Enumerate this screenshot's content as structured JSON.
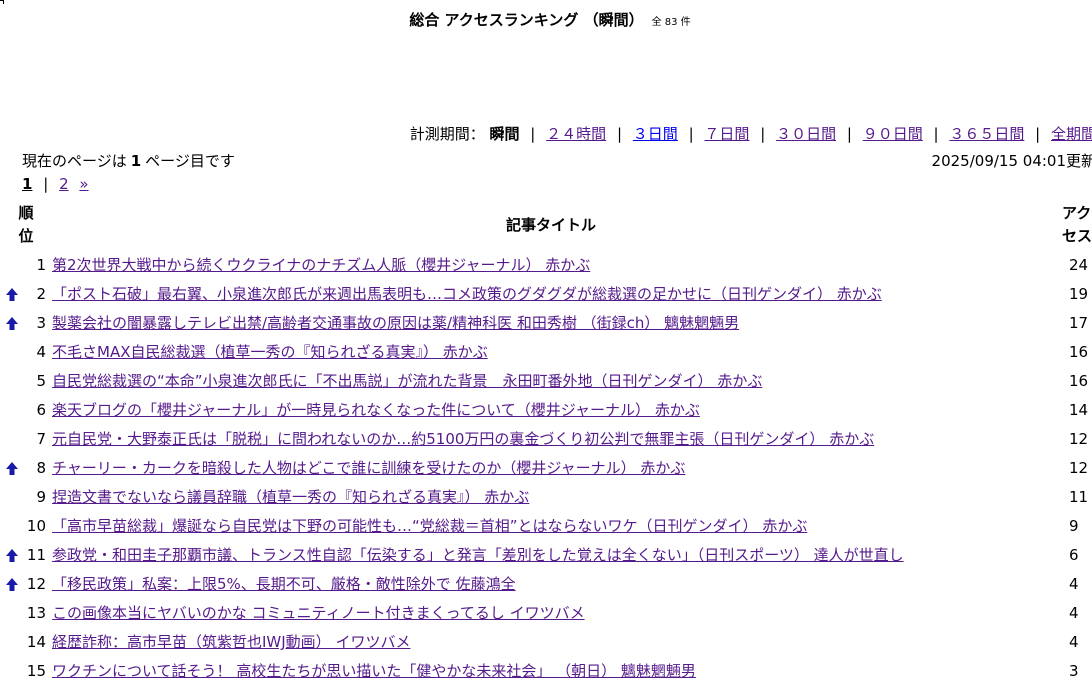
{
  "header": {
    "title": "総合 アクセスランキング （瞬間）",
    "count": "全 83 件"
  },
  "period": {
    "label": "計測期間：",
    "current": "瞬間",
    "options": [
      "２４時間",
      "３日間",
      "７日間",
      "３０日間",
      "９０日間",
      "３６５日間",
      "全期間"
    ]
  },
  "status": {
    "prefix": "現在のページは",
    "page": "1",
    "suffix": "ページ目です",
    "updated": "2025/09/15 04:01更新"
  },
  "pager": {
    "current": "1",
    "next_page": "2",
    "next_icon": "»"
  },
  "columns": {
    "rank": "順位",
    "title": "記事タイトル",
    "access": "アクセス"
  },
  "rows": [
    {
      "rank": "1",
      "title": "第2次世界大戦中から続くウクライナのナチズム人脈（櫻井ジャーナル） 赤かぶ",
      "access": "24",
      "arrow": "none"
    },
    {
      "rank": "2",
      "title": "「ポスト石破」最右翼、小泉進次郎氏が来週出馬表明も…コメ政策のグダグダが総裁選の足かせに（日刊ゲンダイ） 赤かぶ",
      "access": "19",
      "arrow": "up"
    },
    {
      "rank": "3",
      "title": "製薬会社の闇暴露しテレビ出禁/高齢者交通事故の原因は薬/精神科医 和田秀樹 （街録ch）  魑魅魍魎男",
      "access": "17",
      "arrow": "up"
    },
    {
      "rank": "4",
      "title": "不毛さMAX自民総裁選（植草一秀の『知られざる真実』） 赤かぶ",
      "access": "16",
      "arrow": "none"
    },
    {
      "rank": "5",
      "title": "自民党総裁選の“本命”小泉進次郎氏に「不出馬説」が流れた背景　永田町番外地（日刊ゲンダイ） 赤かぶ",
      "access": "16",
      "arrow": "none"
    },
    {
      "rank": "6",
      "title": "楽天ブログの「櫻井ジャーナル」が一時見られなくなった件について（櫻井ジャーナル） 赤かぶ",
      "access": "14",
      "arrow": "none"
    },
    {
      "rank": "7",
      "title": "元自民党・大野泰正氏は「脱税」に問われないのか…約5100万円の裏金づくり初公判で無罪主張（日刊ゲンダイ） 赤かぶ",
      "access": "12",
      "arrow": "none"
    },
    {
      "rank": "8",
      "title": "チャーリー・カークを暗殺した人物はどこで誰に訓練を受けたのか（櫻井ジャーナル） 赤かぶ",
      "access": "12",
      "arrow": "up"
    },
    {
      "rank": "9",
      "title": "捏造文書でないなら議員辞職（植草一秀の『知られざる真実』） 赤かぶ",
      "access": "11",
      "arrow": "none"
    },
    {
      "rank": "10",
      "title": "「高市早苗総裁」爆誕なら自民党は下野の可能性も…“党総裁＝首相”とはならないワケ（日刊ゲンダイ） 赤かぶ",
      "access": "9",
      "arrow": "none"
    },
    {
      "rank": "11",
      "title": "参政党・和田圭子那覇市議、トランス性自認「伝染する」と発言「差別をした覚えは全くない」（日刊スポーツ） 達人が世直し",
      "access": "6",
      "arrow": "up"
    },
    {
      "rank": "12",
      "title": "「移民政策」私案：上限5%、長期不可、厳格・敵性除外で 佐藤鴻全",
      "access": "4",
      "arrow": "up"
    },
    {
      "rank": "13",
      "title": "この画像本当にヤバいのかな コミュニティノート付きまくってるし イワツバメ",
      "access": "4",
      "arrow": "none"
    },
    {
      "rank": "14",
      "title": "経歴詐称：高市早苗（筑紫哲也IWJ動画） イワツバメ",
      "access": "4",
      "arrow": "none"
    },
    {
      "rank": "15",
      "title": "ワクチンについて話そう！ 高校生たちが思い描いた「健やかな未来社会」 （朝日）  魑魅魍魎男",
      "access": "3",
      "arrow": "none"
    }
  ],
  "colors": {
    "link_visited": "#551a8b",
    "link_unvisited": "#0000ee",
    "arrow_up": "#1a1aaa"
  }
}
